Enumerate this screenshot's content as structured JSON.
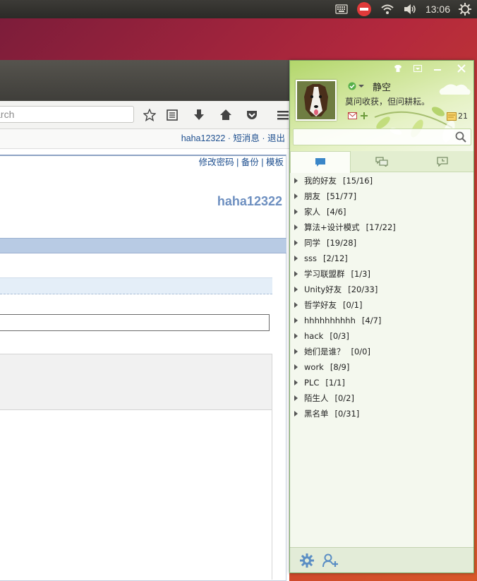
{
  "panel": {
    "clock": "13:06",
    "icons": [
      "keyboard-icon",
      "do-not-disturb-icon",
      "wifi-icon",
      "volume-icon",
      "power-icon"
    ]
  },
  "browser": {
    "search_placeholder": "Search",
    "links_bar": "haha12322 · 短消息 · 退出",
    "page": {
      "top_links": "修改密码 | 备份 | 模板",
      "username": "haha12322"
    }
  },
  "qq": {
    "nickname": "静空",
    "signature": "莫问收获，但问耕耘。",
    "message_count": "21",
    "groups": [
      {
        "name": "我的好友",
        "count": "[15/16]"
      },
      {
        "name": "朋友",
        "count": "[51/77]"
      },
      {
        "name": "家人",
        "count": "[4/6]"
      },
      {
        "name": "算法+设计模式",
        "count": "[17/22]"
      },
      {
        "name": "同学",
        "count": "[19/28]"
      },
      {
        "name": "sss",
        "count": "[2/12]"
      },
      {
        "name": "学习联盟群",
        "count": "[1/3]"
      },
      {
        "name": "Unity好友",
        "count": "[20/33]"
      },
      {
        "name": "哲学好友",
        "count": "[0/1]"
      },
      {
        "name": "hhhhhhhhhh",
        "count": "[4/7]"
      },
      {
        "name": "hack",
        "count": "[0/3]"
      },
      {
        "name": "她们是谁？",
        "count": "[0/0]"
      },
      {
        "name": "work",
        "count": "[8/9]"
      },
      {
        "name": "PLC",
        "count": "[1/1]"
      },
      {
        "name": "陌生人",
        "count": "[0/2]"
      },
      {
        "name": "黑名单",
        "count": "[0/31]"
      }
    ],
    "colors": {
      "accent": "#8cc04a",
      "border": "#7aa866"
    }
  }
}
